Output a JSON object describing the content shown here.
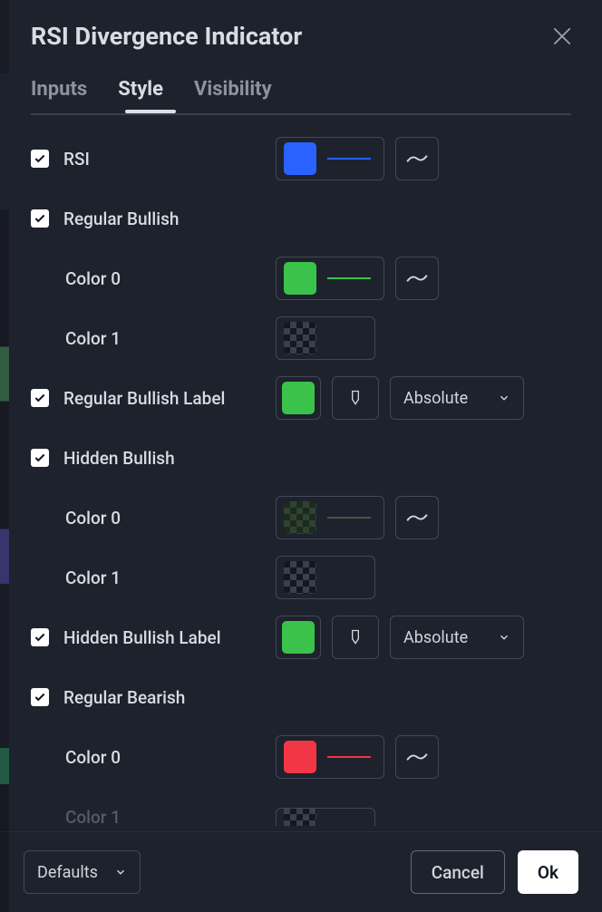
{
  "dialog": {
    "title": "RSI Divergence Indicator"
  },
  "tabs": {
    "inputs": "Inputs",
    "style": "Style",
    "visibility": "Visibility",
    "active": "style"
  },
  "rows": {
    "rsi": {
      "label": "RSI",
      "checked": true,
      "color": "#2962ff",
      "line_color": "#2962ff"
    },
    "reg_bull": {
      "label": "Regular Bullish",
      "checked": true
    },
    "reg_bull_c0": {
      "label": "Color 0",
      "color": "#3ac24a",
      "line_color": "#3ac24a"
    },
    "reg_bull_c1": {
      "label": "Color 1",
      "color": "checker"
    },
    "reg_bull_label": {
      "label": "Regular Bullish Label",
      "checked": true,
      "color": "#3ac24a",
      "select": "Absolute"
    },
    "hid_bull": {
      "label": "Hidden Bullish",
      "checked": true
    },
    "hid_bull_c0": {
      "label": "Color 0",
      "color": "checker-green",
      "line_color": "#3e5a45"
    },
    "hid_bull_c1": {
      "label": "Color 1",
      "color": "checker"
    },
    "hid_bull_label": {
      "label": "Hidden Bullish Label",
      "checked": true,
      "color": "#3ac24a",
      "select": "Absolute"
    },
    "reg_bear": {
      "label": "Regular Bearish",
      "checked": true
    },
    "reg_bear_c0": {
      "label": "Color 0",
      "color": "#f23645",
      "line_color": "#f23645"
    },
    "reg_bear_c1": {
      "label": "Color 1",
      "color": "checker"
    }
  },
  "footer": {
    "defaults": "Defaults",
    "cancel": "Cancel",
    "ok": "Ok"
  }
}
